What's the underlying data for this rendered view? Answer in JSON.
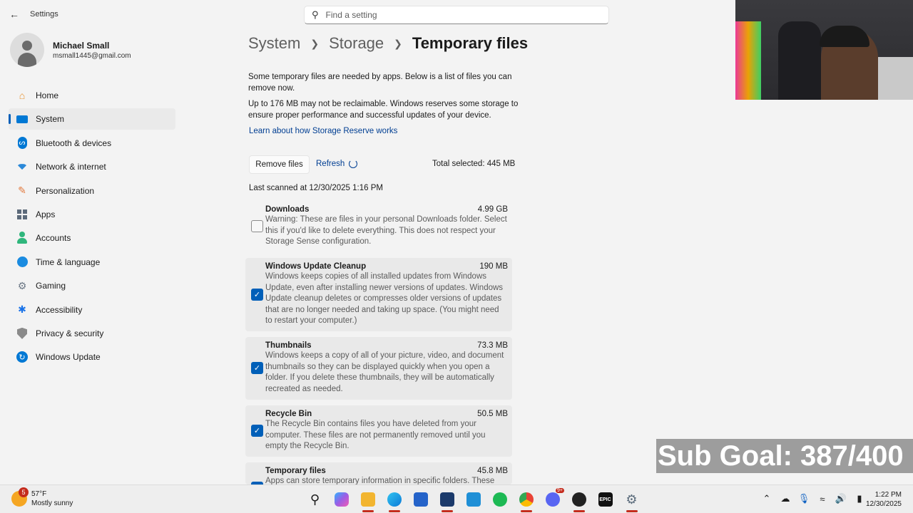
{
  "window": {
    "title": "Settings",
    "search_placeholder": "Find a setting"
  },
  "profile": {
    "name": "Michael Small",
    "email": "msmall1445@gmail.com"
  },
  "nav": {
    "items": [
      {
        "label": "Home",
        "icon": "home-icon",
        "color": "#e8912d"
      },
      {
        "label": "System",
        "icon": "system-icon",
        "color": "#0078d4"
      },
      {
        "label": "Bluetooth & devices",
        "icon": "bluetooth-icon",
        "color": "#0078d4"
      },
      {
        "label": "Network & internet",
        "icon": "wifi-icon",
        "color": "#2b88d8"
      },
      {
        "label": "Personalization",
        "icon": "brush-icon",
        "color": "#e27a3f"
      },
      {
        "label": "Apps",
        "icon": "apps-icon",
        "color": "#5c6a7a"
      },
      {
        "label": "Accounts",
        "icon": "accounts-icon",
        "color": "#2fb67c"
      },
      {
        "label": "Time & language",
        "icon": "globe-clock-icon",
        "color": "#0078d4"
      },
      {
        "label": "Gaming",
        "icon": "gaming-icon",
        "color": "#6b7785"
      },
      {
        "label": "Accessibility",
        "icon": "accessibility-icon",
        "color": "#1a73e8"
      },
      {
        "label": "Privacy & security",
        "icon": "shield-icon",
        "color": "#7a7a7a"
      },
      {
        "label": "Windows Update",
        "icon": "update-icon",
        "color": "#0078d4"
      }
    ]
  },
  "breadcrumb": {
    "items": [
      "System",
      "Storage"
    ],
    "current": "Temporary files"
  },
  "main": {
    "intro": "Some temporary files are needed by apps. Below is a list of files you can remove now.",
    "reserve_note": "Up to 176 MB may not be reclaimable. Windows reserves some storage to ensure proper performance and successful updates of your device.",
    "learn_link": "Learn about how Storage Reserve works",
    "remove_button": "Remove files",
    "refresh_link": "Refresh",
    "total_selected": "Total selected: 445 MB",
    "last_scanned": "Last scanned at 12/30/2025 1:16 PM"
  },
  "files": [
    {
      "name": "Downloads",
      "size": "4.99 GB",
      "checked": false,
      "desc": "Warning: These are files in your personal Downloads folder. Select this if you'd like to delete everything. This does not respect your Storage Sense configuration."
    },
    {
      "name": "Windows Update Cleanup",
      "size": "190 MB",
      "checked": true,
      "desc": "Windows keeps copies of all installed updates from Windows Update, even after installing newer versions of updates. Windows Update cleanup deletes or compresses older versions of updates that are no longer needed and taking up space. (You might need to restart your computer.)"
    },
    {
      "name": "Thumbnails",
      "size": "73.3 MB",
      "checked": true,
      "desc": "Windows keeps a copy of all of your picture, video, and document thumbnails so they can be displayed quickly when you open a folder. If you delete these thumbnails, they will be automatically recreated as needed."
    },
    {
      "name": "Recycle Bin",
      "size": "50.5 MB",
      "checked": true,
      "desc": "The Recycle Bin contains files you have deleted from your computer. These files are not permanently removed until you empty the Recycle Bin."
    },
    {
      "name": "Temporary files",
      "size": "45.8 MB",
      "checked": true,
      "desc": "Apps can store temporary information in specific folders. These"
    }
  ],
  "overlay": {
    "sub_goal": "Sub Goal: 387/400"
  },
  "taskbar": {
    "weather_temp": "57°F",
    "weather_desc": "Mostly sunny",
    "weather_badge": "5",
    "time": "1:22 PM",
    "date": "12/30/2025",
    "apps": [
      {
        "icon": "windows-start-icon",
        "color": "#0a84ff",
        "running": false
      },
      {
        "icon": "search-icon",
        "color": "#1b1b1b",
        "running": false
      },
      {
        "icon": "copilot-icon",
        "color": "#9b5de5",
        "running": false
      },
      {
        "icon": "file-explorer-icon",
        "color": "#f2b530",
        "running": true
      },
      {
        "icon": "edge-icon",
        "color": "#0c7bd8",
        "running": true
      },
      {
        "icon": "store-icon",
        "color": "#2563c9",
        "running": false
      },
      {
        "icon": "editor-icon",
        "color": "#1b3a6b",
        "running": true
      },
      {
        "icon": "photos-icon",
        "color": "#1f8fd6",
        "running": false
      },
      {
        "icon": "evernote-icon",
        "color": "#1db954",
        "running": false
      },
      {
        "icon": "chrome-icon",
        "color": "#e94235",
        "running": true
      },
      {
        "icon": "discord-icon",
        "color": "#5865f2",
        "running": false
      },
      {
        "icon": "obs-icon",
        "color": "#222222",
        "running": true
      },
      {
        "icon": "epic-games-icon",
        "color": "#111111",
        "running": false
      },
      {
        "icon": "settings-icon",
        "color": "#5a6b7b",
        "running": true
      }
    ],
    "discord_badge": "9+"
  }
}
